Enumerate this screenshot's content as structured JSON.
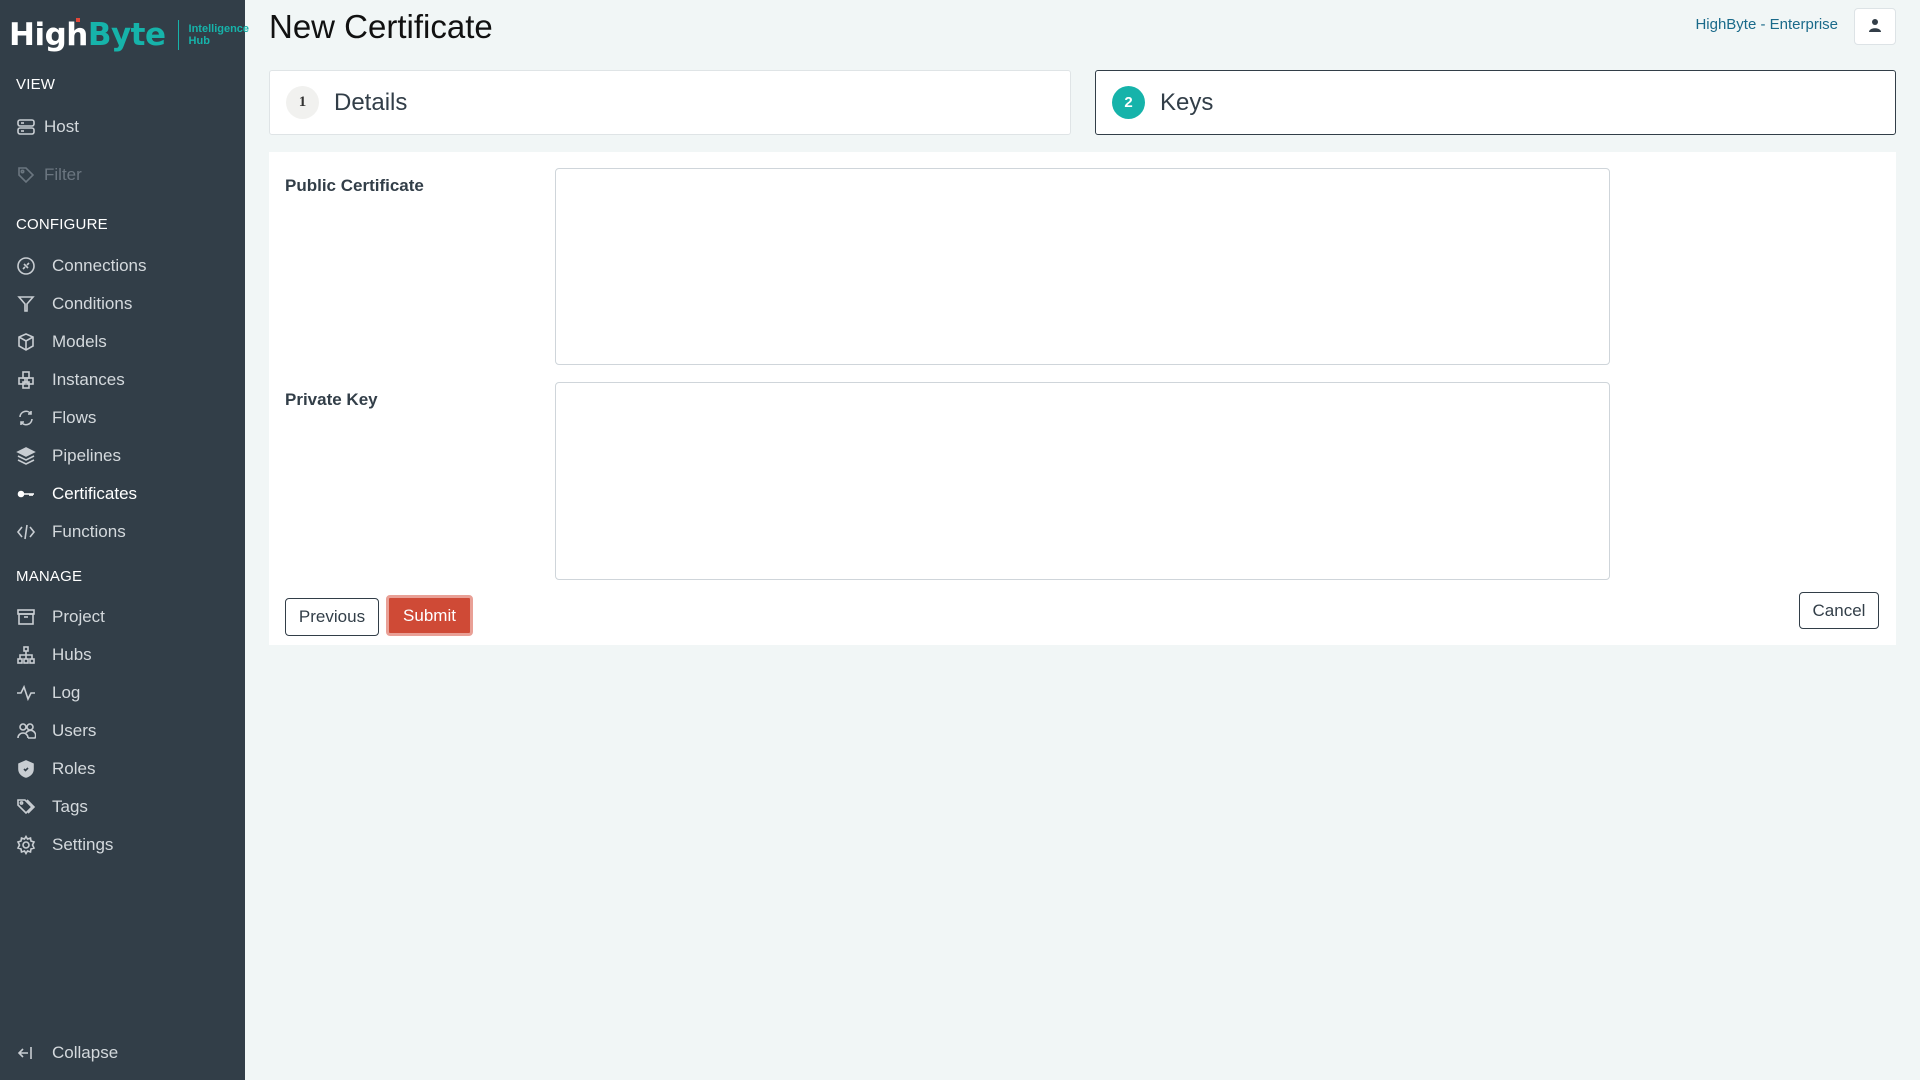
{
  "brand": {
    "name_part1": "High",
    "name_part2": "Byte",
    "sub_line1": "Intelligence",
    "sub_line2": "Hub"
  },
  "sidebar": {
    "sections": {
      "view": "VIEW",
      "configure": "CONFIGURE",
      "manage": "MANAGE"
    },
    "view_items": [
      {
        "label": "Host",
        "icon": "server-icon"
      },
      {
        "label": "Filter",
        "icon": "tag-icon",
        "disabled": true
      }
    ],
    "configure_items": [
      {
        "label": "Connections",
        "icon": "plug-icon"
      },
      {
        "label": "Conditions",
        "icon": "filter-icon"
      },
      {
        "label": "Models",
        "icon": "cube-icon"
      },
      {
        "label": "Instances",
        "icon": "cubes-icon"
      },
      {
        "label": "Flows",
        "icon": "sync-icon"
      },
      {
        "label": "Pipelines",
        "icon": "layers-icon"
      },
      {
        "label": "Certificates",
        "icon": "key-icon",
        "active": true
      },
      {
        "label": "Functions",
        "icon": "code-icon"
      }
    ],
    "manage_items": [
      {
        "label": "Project",
        "icon": "archive-icon"
      },
      {
        "label": "Hubs",
        "icon": "hierarchy-icon"
      },
      {
        "label": "Log",
        "icon": "activity-icon"
      },
      {
        "label": "Users",
        "icon": "users-icon"
      },
      {
        "label": "Roles",
        "icon": "shield-icon"
      },
      {
        "label": "Tags",
        "icon": "tags-icon"
      },
      {
        "label": "Settings",
        "icon": "gear-icon"
      }
    ],
    "collapse_label": "Collapse"
  },
  "header": {
    "title": "New Certificate",
    "org_name": "HighByte - Enterprise"
  },
  "steps": [
    {
      "number": "1",
      "label": "Details",
      "active": false
    },
    {
      "number": "2",
      "label": "Keys",
      "active": true
    }
  ],
  "form": {
    "public_certificate_label": "Public Certificate",
    "public_certificate_value": "",
    "private_key_label": "Private Key",
    "private_key_value": "",
    "previous_label": "Previous",
    "submit_label": "Submit",
    "cancel_label": "Cancel"
  },
  "colors": {
    "sidebar_bg": "#323e48",
    "accent_teal": "#16b3aa",
    "submit_red": "#cf4a36",
    "page_bg": "#f1f6f6"
  }
}
